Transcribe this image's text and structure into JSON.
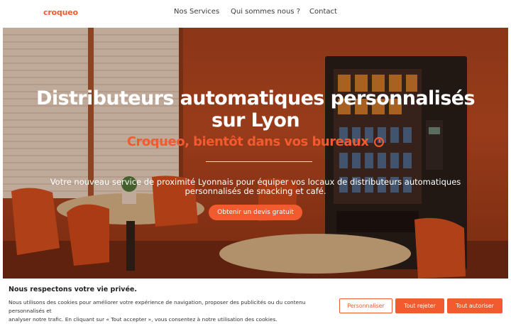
{
  "header": {
    "logo": "croqueo",
    "nav": [
      "Nos Services",
      "Qui sommes nous ?",
      "Contact"
    ]
  },
  "hero": {
    "title_line1": "Distributeurs automatiques personnalisés",
    "title_line2": "sur Lyon",
    "subtitle": "Croqueo, bientôt dans vos bureaux",
    "description_line1": "Votre nouveau service de proximité Lyonnais pour équiper vos locaux de distributeurs automatiques",
    "description_line2": "personnalisés de snacking et café.",
    "cta": "Obtenir un devis gratuit"
  },
  "cookie": {
    "title": "Nous respectons votre vie privée.",
    "text_line1": "Nous utilisons des cookies pour améliorer votre expérience de navigation, proposer des publicités ou du contenu personnalisés et",
    "text_line2": "analyser notre trafic. En cliquant sur « Tout accepter », vous consentez à notre utilisation des cookies.",
    "btn_customize": "Personnaliser",
    "btn_reject": "Tout rejeter",
    "btn_accept": "Tout autoriser"
  },
  "colors": {
    "brand": "#f25a30",
    "wall": "#b84a22"
  }
}
